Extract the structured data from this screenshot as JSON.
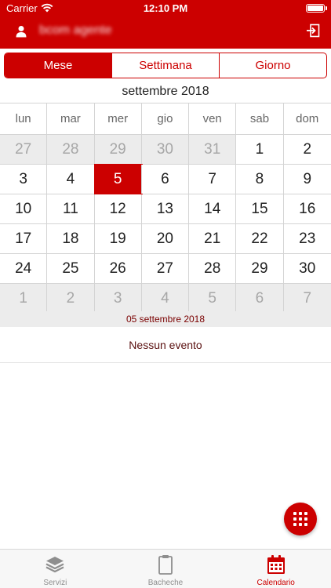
{
  "status": {
    "carrier": "Carrier",
    "time": "12:10 PM"
  },
  "header": {
    "user_name": "bcom agente"
  },
  "view_tabs": [
    {
      "label": "Mese",
      "active": true
    },
    {
      "label": "Settimana",
      "active": false
    },
    {
      "label": "Giorno",
      "active": false
    }
  ],
  "calendar": {
    "month_title": "settembre 2018",
    "weekdays": [
      "lun",
      "mar",
      "mer",
      "gio",
      "ven",
      "sab",
      "dom"
    ],
    "weeks": [
      [
        "27",
        "28",
        "29",
        "30",
        "31",
        "1",
        "2"
      ],
      [
        "3",
        "4",
        "5",
        "6",
        "7",
        "8",
        "9"
      ],
      [
        "10",
        "11",
        "12",
        "13",
        "14",
        "15",
        "16"
      ],
      [
        "17",
        "18",
        "19",
        "20",
        "21",
        "22",
        "23"
      ],
      [
        "24",
        "25",
        "26",
        "27",
        "28",
        "29",
        "30"
      ],
      [
        "1",
        "2",
        "3",
        "4",
        "5",
        "6",
        "7"
      ]
    ],
    "selected_date": "05 settembre 2018",
    "no_events": "Nessun evento"
  },
  "tab_bar": [
    {
      "label": "Servizi",
      "icon": "layers-icon",
      "active": false
    },
    {
      "label": "Bacheche",
      "icon": "clipboard-icon",
      "active": false
    },
    {
      "label": "Calendario",
      "icon": "calendar-icon",
      "active": true
    }
  ],
  "colors": {
    "accent": "#cc0000",
    "muted_cell": "#ececec"
  }
}
